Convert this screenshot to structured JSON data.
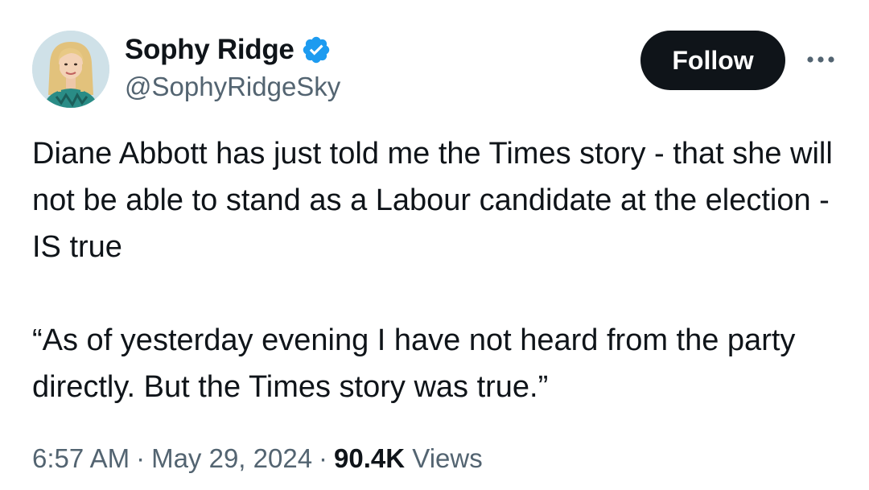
{
  "author": {
    "display_name": "Sophy Ridge",
    "handle": "@SophyRidgeSky",
    "verified": true,
    "verified_color": "#1d9bf0"
  },
  "actions": {
    "follow_label": "Follow",
    "more_icon": "more-horizontal-icon"
  },
  "tweet": {
    "paragraph_1": "Diane Abbott has just told me the Times story - that she will not be able to stand as a Labour candidate at the election - IS true",
    "paragraph_2": "“As of yesterday evening I have not heard from the party directly. But the Times story was true.”"
  },
  "meta": {
    "time": "6:57 AM",
    "separator": "·",
    "date": "May 29, 2024",
    "views_count": "90.4K",
    "views_label": "Views"
  },
  "colors": {
    "text_primary": "#0f1419",
    "text_secondary": "#536471",
    "button_bg": "#0f1419",
    "button_text": "#ffffff"
  }
}
